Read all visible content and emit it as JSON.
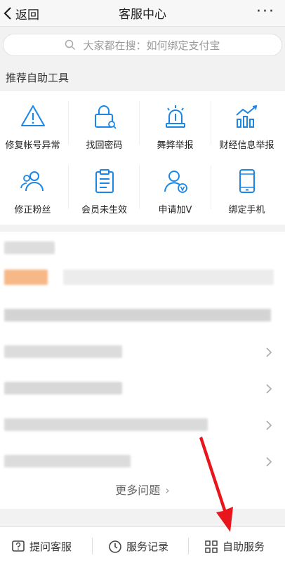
{
  "nav": {
    "back_label": "返回",
    "title": "客服中心",
    "more_label": "···"
  },
  "search": {
    "placeholder": "大家都在搜：如何绑定支付宝"
  },
  "tools_section": {
    "title": "推荐自助工具",
    "items": [
      {
        "label": "修复帐号异常",
        "icon": "warning-icon"
      },
      {
        "label": "找回密码",
        "icon": "lock-icon"
      },
      {
        "label": "舞弊举报",
        "icon": "siren-icon"
      },
      {
        "label": "财经信息举报",
        "icon": "chart-trend-icon"
      },
      {
        "label": "修正粉丝",
        "icon": "users-icon"
      },
      {
        "label": "会员未生效",
        "icon": "clipboard-icon"
      },
      {
        "label": "申请加V",
        "icon": "user-v-icon"
      },
      {
        "label": "绑定手机",
        "icon": "phone-icon"
      }
    ]
  },
  "faq": {
    "more_label": "更多问题"
  },
  "footer": {
    "ask_label": "提问客服",
    "records_label": "服务记录",
    "self_service_label": "自助服务"
  },
  "colors": {
    "accent": "#1a87e6",
    "annotation": "#e8161c"
  }
}
